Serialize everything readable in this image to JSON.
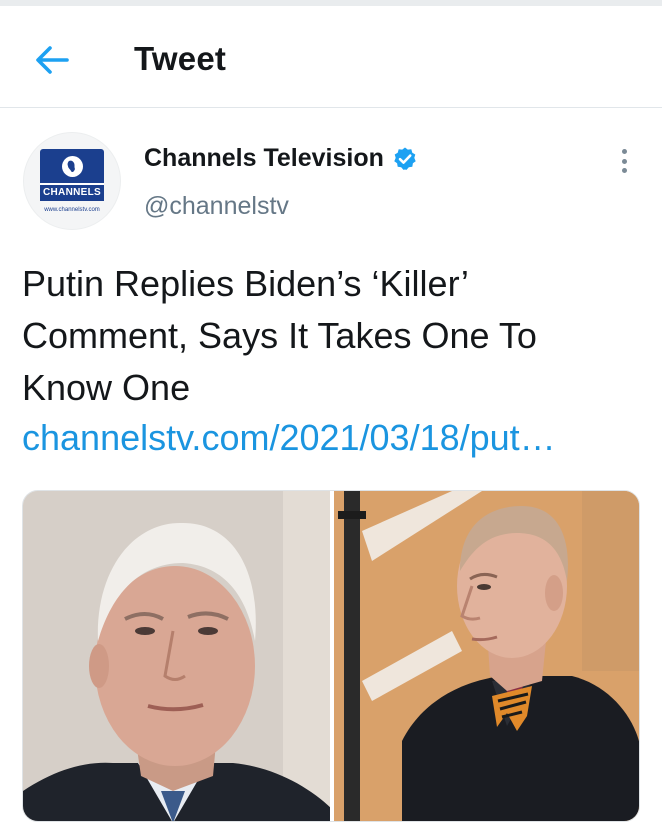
{
  "header": {
    "title": "Tweet",
    "back_icon": "arrow-left-icon",
    "accent_color": "#1da1f2"
  },
  "tweet": {
    "author": {
      "display_name": "Channels Television",
      "handle": "@channelstv",
      "verified": true,
      "avatar": {
        "brand_text": "CHANNELS",
        "url_text": "www.channelstv.com",
        "brand_color": "#1b3f8e"
      }
    },
    "text_lines": [
      "Putin Replies Biden’s ‘Killer’",
      "Comment, Says It Takes One To",
      "Know One"
    ],
    "link": "channelstv.com/2021/03/18/put…",
    "link_color": "#1b95e0",
    "media": {
      "left_photo": "man-in-suit-photo",
      "right_photo": "man-in-coat-photo"
    }
  }
}
